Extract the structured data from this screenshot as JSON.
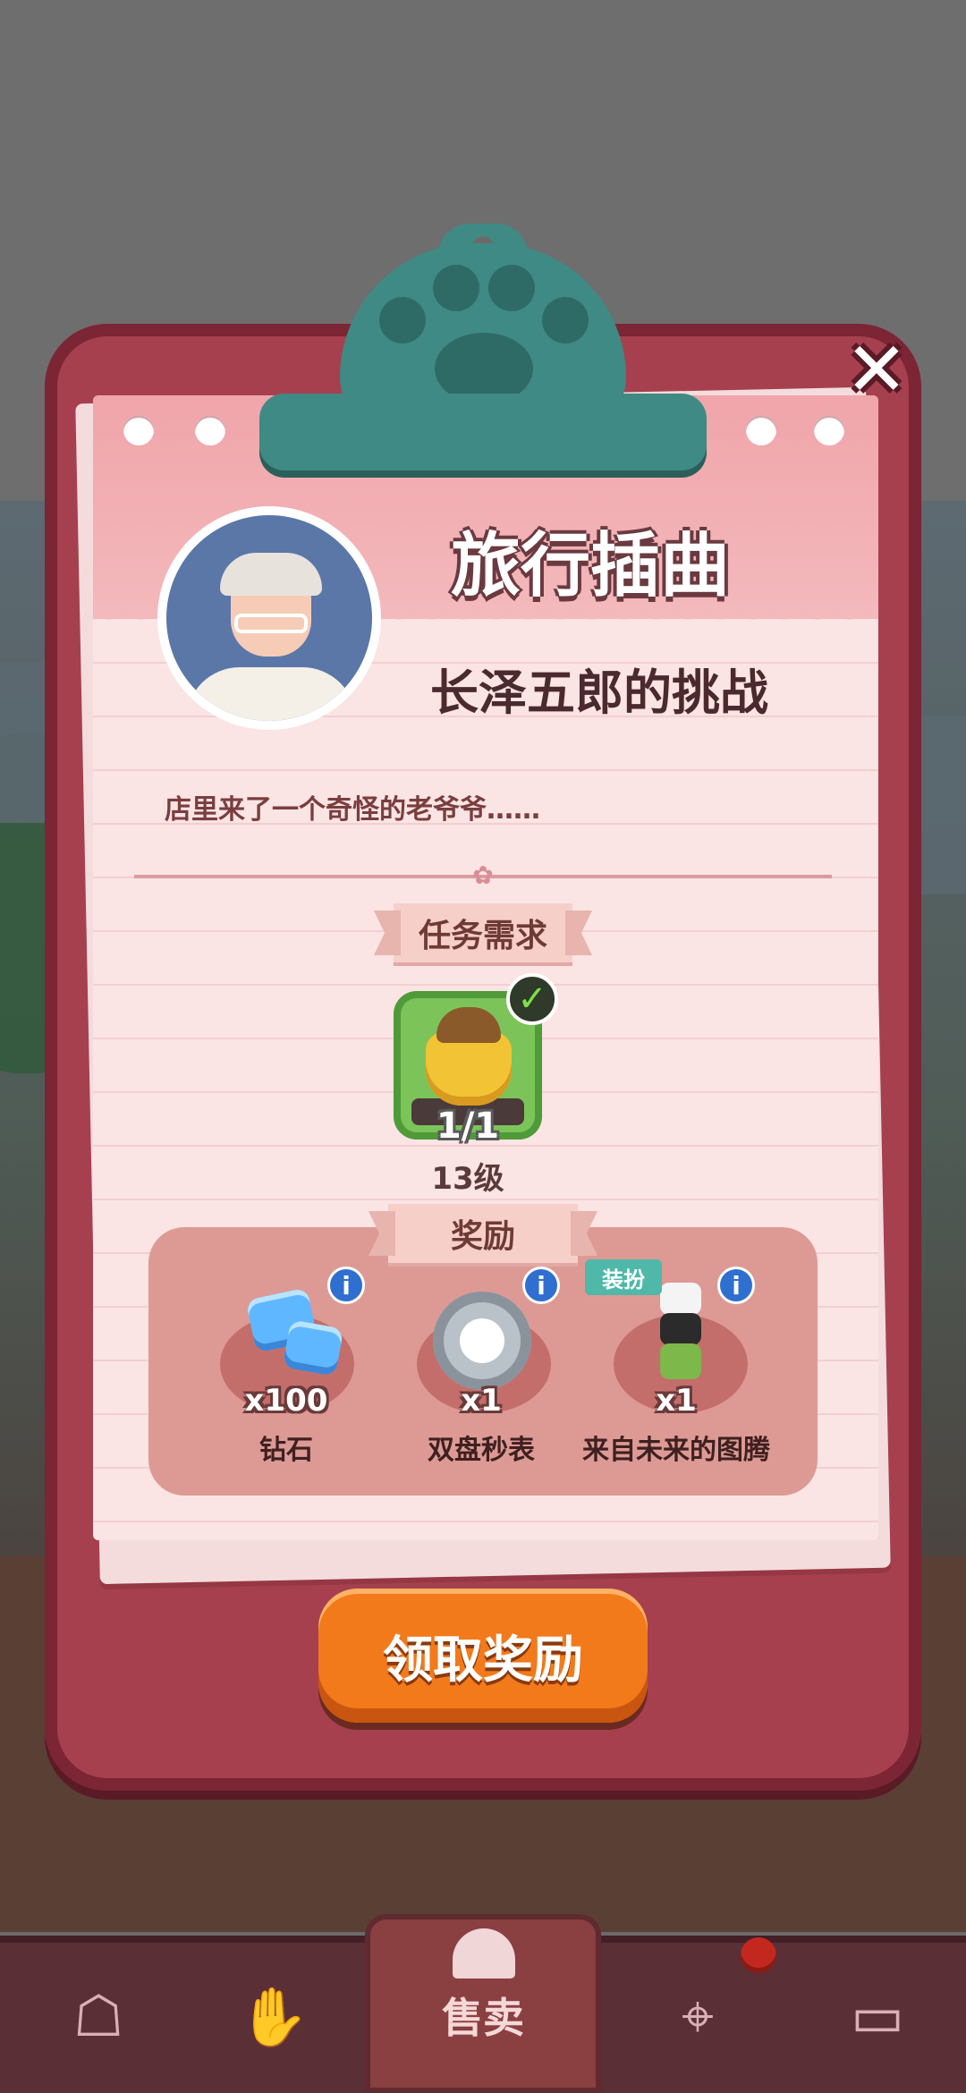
{
  "modal": {
    "title": "旅行插曲",
    "subtitle": "长泽五郎的挑战",
    "description": "店里来了一个奇怪的老爷爷……",
    "close_label": "✕"
  },
  "task": {
    "section_label": "任务需求",
    "progress": "1/1",
    "level": "13级",
    "completed": true
  },
  "rewards": {
    "section_label": "奖励",
    "items": [
      {
        "qty": "x100",
        "name": "钻石",
        "icon": "diamond-icon"
      },
      {
        "qty": "x1",
        "name": "双盘秒表",
        "icon": "stopwatch-icon"
      },
      {
        "qty": "x1",
        "name": "来自未来的图腾",
        "icon": "totem-icon",
        "tag": "装扮"
      }
    ]
  },
  "claim_button": "领取奖励",
  "nav": {
    "active_label": "售卖",
    "items": [
      "bag-icon",
      "handshake-icon",
      "sell-bell-icon",
      "map-pin-icon",
      "bus-icon"
    ]
  },
  "colors": {
    "board": "#a6404f",
    "accent_orange": "#f27a1a",
    "clip_teal": "#3f8a84"
  }
}
